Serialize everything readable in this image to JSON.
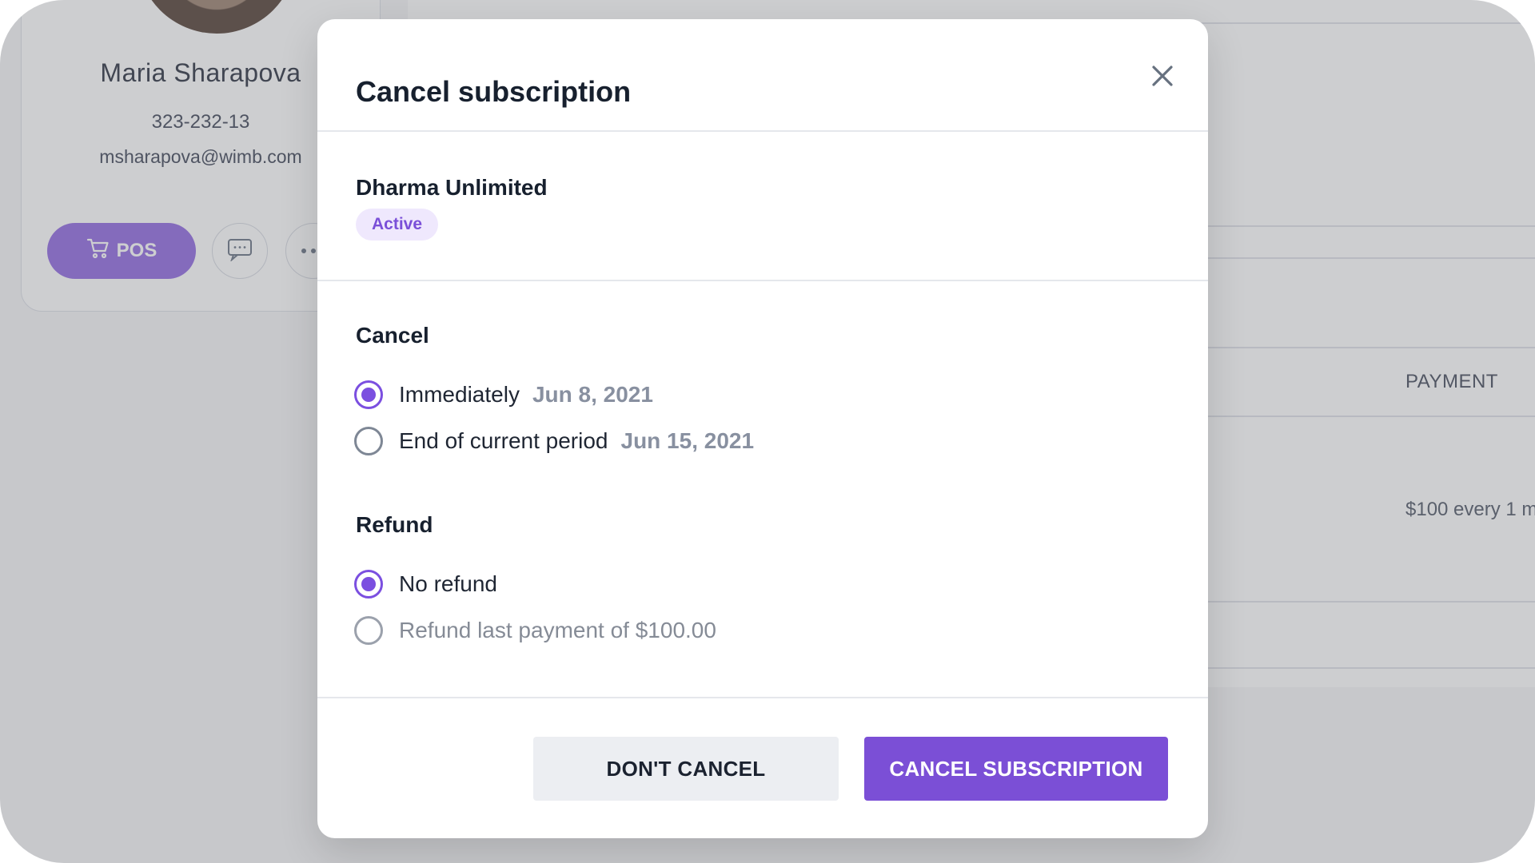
{
  "background": {
    "profile": {
      "name": "Maria Sharapova",
      "phone": "323-232-13",
      "email": "msharapova@wimb.com",
      "pos_label": "POS"
    },
    "table": {
      "payment_header": "PAYMENT",
      "payment_value": "$100 every 1 m"
    }
  },
  "modal": {
    "title": "Cancel subscription",
    "subscription": {
      "name": "Dharma Unlimited",
      "status": "Active"
    },
    "cancel_section": {
      "label": "Cancel",
      "options": [
        {
          "label": "Immediately",
          "date": "Jun 8, 2021",
          "selected": true
        },
        {
          "label": "End of current period",
          "date": "Jun 15, 2021",
          "selected": false
        }
      ]
    },
    "refund_section": {
      "label": "Refund",
      "options": [
        {
          "label": "No refund",
          "selected": true
        },
        {
          "label": "Refund last payment of $100.00",
          "selected": false,
          "disabled": true
        }
      ]
    },
    "buttons": {
      "secondary": "DON'T CANCEL",
      "primary": "CANCEL SUBSCRIPTION"
    }
  },
  "colors": {
    "accent": "#7b4fd6",
    "badge_bg": "#efe8fd",
    "badge_text": "#7a4fd8"
  }
}
